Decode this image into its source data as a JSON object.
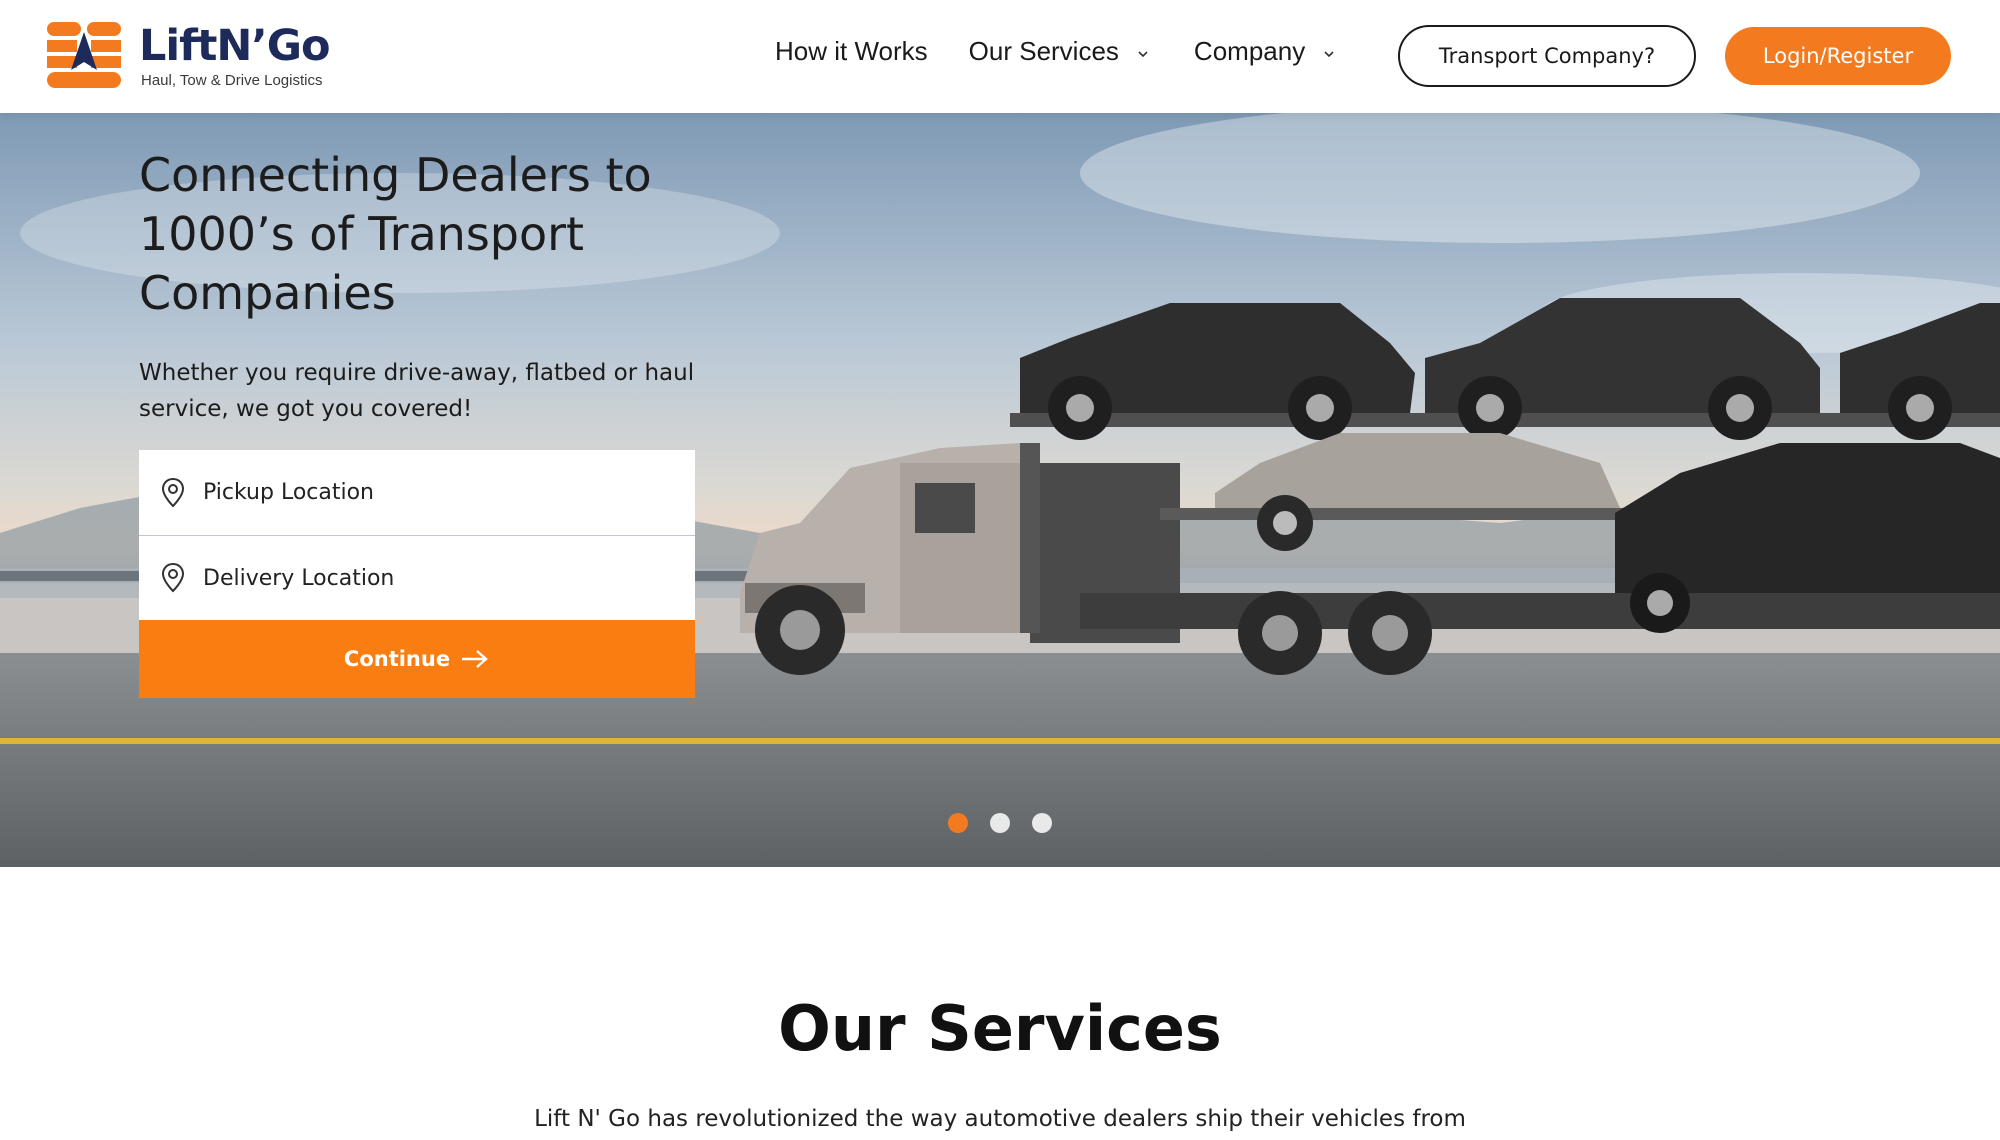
{
  "brand": {
    "name": "LiftN’Go",
    "tagline": "Haul, Tow & Drive Logistics",
    "colors": {
      "accent": "#f47a1f",
      "navy": "#1d2a5a"
    }
  },
  "nav": {
    "items": [
      {
        "label": "How it Works",
        "has_dropdown": false
      },
      {
        "label": "Our Services",
        "has_dropdown": true
      },
      {
        "label": "Company",
        "has_dropdown": true
      }
    ],
    "transport_button": "Transport Company?",
    "login_button": "Login/Register"
  },
  "hero": {
    "title": "Connecting Dealers to 1000’s of Transport Companies",
    "subtitle": "Whether you require drive-away, flatbed or haul service, we got you covered!",
    "form": {
      "pickup_placeholder": "Pickup Location",
      "delivery_placeholder": "Delivery Location",
      "continue_label": "Continue"
    },
    "carousel": {
      "slides": 3,
      "active": 1
    }
  },
  "services": {
    "title": "Our Services",
    "intro": "Lift N' Go has revolutionized the way automotive dealers ship their vehicles from"
  },
  "icons": [
    "logo-icon",
    "chevron-down-icon",
    "location-pin-icon",
    "arrow-right-icon"
  ]
}
